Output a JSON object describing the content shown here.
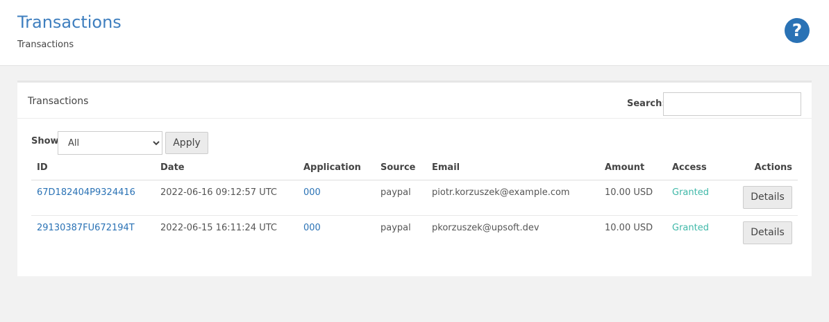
{
  "header": {
    "title": "Transactions",
    "breadcrumb": "Transactions",
    "help_icon": "question-circle-icon",
    "help_glyph": "?"
  },
  "panel": {
    "title": "Transactions",
    "search": {
      "label": "Search:",
      "value": "",
      "placeholder": ""
    },
    "filter": {
      "label": "Show",
      "selected": "All",
      "apply_label": "Apply"
    },
    "columns": [
      "ID",
      "Date",
      "Application",
      "Source",
      "Email",
      "Amount",
      "Access",
      "Actions"
    ],
    "rows": [
      {
        "id": "67D182404P9324416",
        "date": "2022-06-16 09:12:57 UTC",
        "application": "000",
        "source": "paypal",
        "email": "piotr.korzuszek@example.com",
        "amount": "10.00 USD",
        "access": "Granted",
        "action": "Details"
      },
      {
        "id": "29130387FU672194T",
        "date": "2022-06-15 16:11:24 UTC",
        "application": "000",
        "source": "paypal",
        "email": "pkorzuszek@upsoft.dev",
        "amount": "10.00 USD",
        "access": "Granted",
        "action": "Details"
      }
    ]
  },
  "colors": {
    "title": "#3f7fbf",
    "link": "#2a72b5",
    "granted": "#3fb8a8",
    "help_icon_bg": "#2a72b5"
  }
}
